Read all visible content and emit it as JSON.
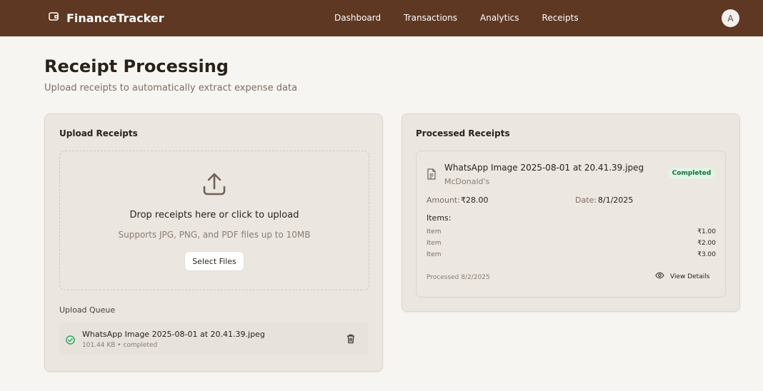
{
  "app": {
    "name": "FinanceTracker"
  },
  "nav": {
    "items": [
      "Dashboard",
      "Transactions",
      "Analytics",
      "Receipts"
    ]
  },
  "user": {
    "initial": "A"
  },
  "header": {
    "title": "Receipt Processing",
    "subtitle": "Upload receipts to automatically extract expense data"
  },
  "upload": {
    "title": "Upload Receipts",
    "drop_title": "Drop receipts here or click to upload",
    "drop_subtitle": "Supports JPG, PNG, and PDF files up to 10MB",
    "select_button": "Select Files",
    "queue_label": "Upload Queue",
    "queue": [
      {
        "name": "WhatsApp Image 2025-08-01 at 20.41.39.jpeg",
        "meta": "101.44 KB • completed"
      }
    ]
  },
  "processed": {
    "title": "Processed Receipts",
    "receipts": [
      {
        "name": "WhatsApp Image 2025-08-01 at 20.41.39.jpeg",
        "merchant": "McDonald's",
        "status": "Completed",
        "amount_label": "Amount:",
        "amount": "₹28.00",
        "date_label": "Date:",
        "date": "8/1/2025",
        "items_label": "Items:",
        "items": [
          {
            "name": "Item",
            "price": "₹1.00"
          },
          {
            "name": "Item",
            "price": "₹2.00"
          },
          {
            "name": "Item",
            "price": "₹3.00"
          }
        ],
        "processed_date": "Processed 8/2/2025",
        "view_details": "View Details"
      }
    ]
  },
  "colors": {
    "topbar": "#5e3823",
    "background": "#f7f5f2",
    "card": "#ebe6df",
    "success": "#22a55a"
  }
}
